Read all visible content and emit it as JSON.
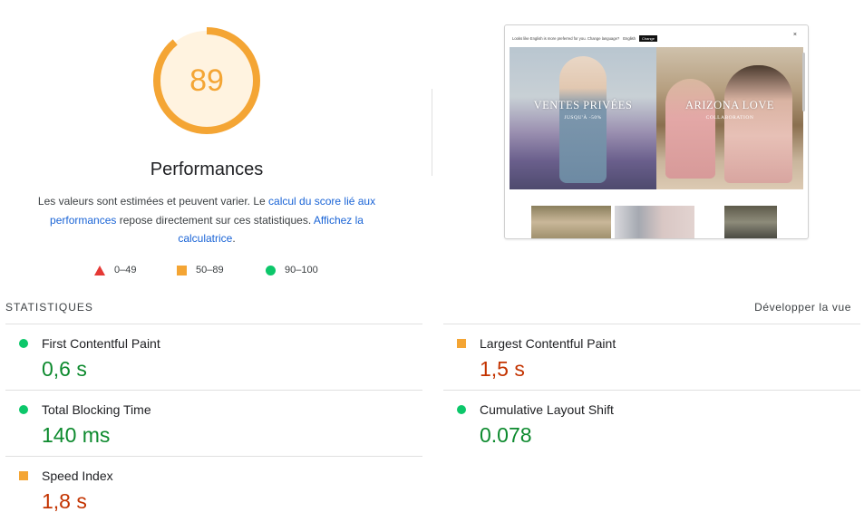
{
  "gauge": {
    "score": "89",
    "score_fraction": 0.89,
    "title": "Performances",
    "color": "#f4a534",
    "track_color": "#fff3e0"
  },
  "description": {
    "part1": "Les valeurs sont estimées et peuvent varier. Le ",
    "link1": "calcul du score lié aux performances",
    "part2": " repose directement sur ces statistiques. ",
    "link2": "Affichez la calculatrice",
    "part3": "."
  },
  "legend": {
    "fail": "0–49",
    "average": "50–89",
    "pass": "90–100"
  },
  "preview": {
    "banner_text": "Looks like English is more preferred for you. Change language?",
    "language": "English",
    "change_label": "Change",
    "close_label": "×",
    "left_title": "VENTES PRIVÉES",
    "left_subtitle": "JUSQU'À -50%",
    "right_title": "ARIZONA LOVE",
    "right_subtitle": "COLLABORATION"
  },
  "stats": {
    "title": "STATISTIQUES",
    "expand_label": "Développer la vue",
    "metrics": [
      {
        "label": "First Contentful Paint",
        "value": "0,6 s",
        "rating": "pass"
      },
      {
        "label": "Largest Contentful Paint",
        "value": "1,5 s",
        "rating": "average"
      },
      {
        "label": "Total Blocking Time",
        "value": "140 ms",
        "rating": "pass"
      },
      {
        "label": "Cumulative Layout Shift",
        "value": "0.078",
        "rating": "pass"
      },
      {
        "label": "Speed Index",
        "value": "1,8 s",
        "rating": "average"
      }
    ]
  },
  "colors": {
    "pass": "#0cc76a",
    "average": "#f4a534",
    "fail": "#e53935",
    "pass_text": "#0d8a2e",
    "average_text": "#c33300",
    "link": "#1a64d6"
  }
}
